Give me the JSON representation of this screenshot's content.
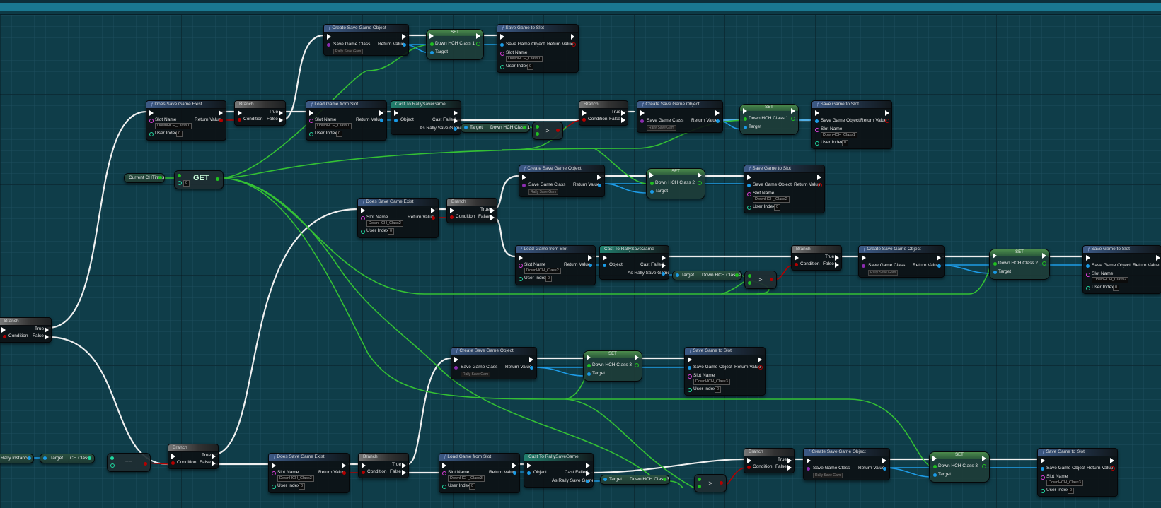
{
  "labels": {
    "does_save_game_exist": "Does Save Game Exist",
    "branch": "Branch",
    "load_game_from_slot": "Load Game from Slot",
    "cast_to": "Cast To RallySaveGame",
    "create_save_game_object": "Create Save Game Object",
    "save_game_to_slot": "Save Game to Slot",
    "set": "SET",
    "get": "GET",
    "slot_name": "Slot Name",
    "user_index": "User Index",
    "return_value": "Return Value",
    "condition": "Condition",
    "true": "True",
    "false": "False",
    "object": "Object",
    "cast_failed": "Cast Failed",
    "as_rally_save_game": "As Rally Save Game",
    "save_game_class": "Save Game Class",
    "save_game_object": "Save Game Object",
    "target": "Target",
    "current_ch_times": "Current CHTimes",
    "rally_instance": "Rally Instance",
    "ch_class": "CH Class",
    "gt": ">",
    "eq": "==",
    "zero": "0",
    "rally_save_game": "Rally Save Gam",
    "down_ch_class_1": "Down HCH Class 1",
    "down_ch_class_2": "Down HCH Class 2",
    "down_ch_class_3": "Down HCH Class 3",
    "slot_1": "DownHCH_Class1",
    "slot_2": "DownHCH_Class2",
    "slot_3": "DownHCH_Class3"
  },
  "colors": {
    "exec": "#ffffff",
    "object_pin": "#1a9be6",
    "bool_pin": "#b40000",
    "int_pin": "#20d8a0",
    "class_pin": "#8b2cb0",
    "string_pin": "#e040e0",
    "wire_green": "#38c038"
  }
}
